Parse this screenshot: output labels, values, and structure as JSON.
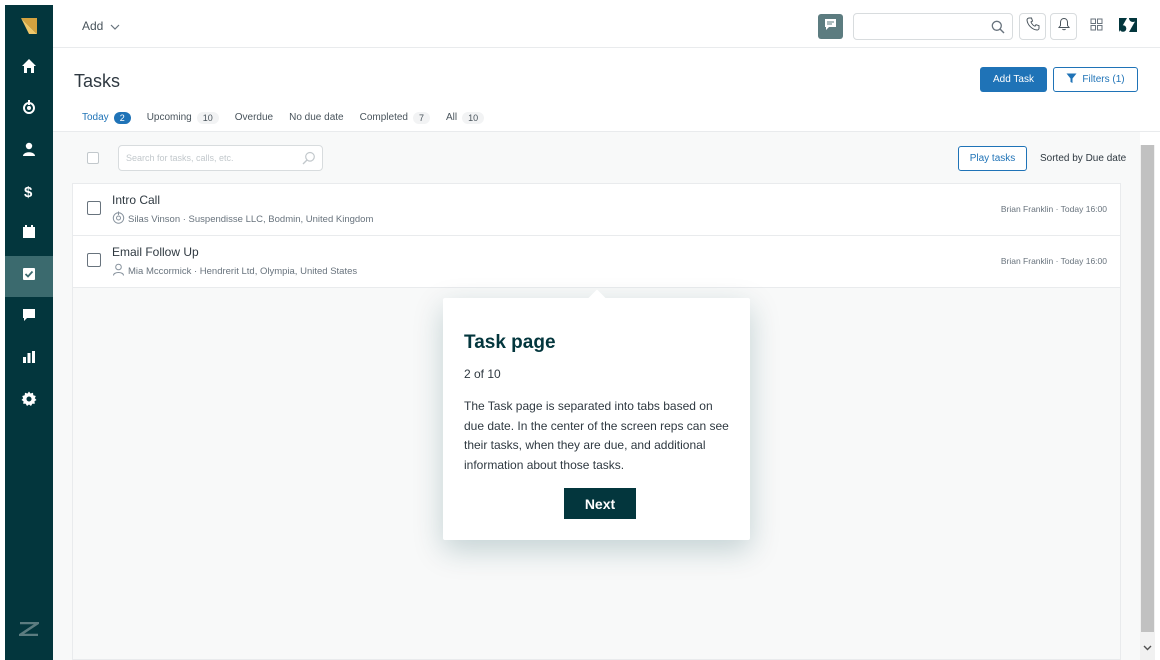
{
  "colors": {
    "sidebar": "#03363d",
    "sidebar_active": "#3b6a6e",
    "primary": "#1f73b7",
    "brand_accent": "#d4a23f"
  },
  "sidebar": {
    "items": [
      {
        "icon": "home-icon"
      },
      {
        "icon": "leads-icon"
      },
      {
        "icon": "contacts-icon"
      },
      {
        "icon": "deals-icon"
      },
      {
        "icon": "calendar-icon"
      },
      {
        "icon": "tasks-icon",
        "active": true
      },
      {
        "icon": "messages-icon"
      },
      {
        "icon": "reports-icon"
      },
      {
        "icon": "settings-icon"
      }
    ]
  },
  "header": {
    "add_label": "Add",
    "search_value": ""
  },
  "page": {
    "title": "Tasks",
    "add_task_label": "Add Task",
    "filters_label": "Filters (1)"
  },
  "tabs": [
    {
      "label": "Today",
      "count": "2",
      "active": true
    },
    {
      "label": "Upcoming",
      "count": "10"
    },
    {
      "label": "Overdue",
      "count": ""
    },
    {
      "label": "No due date",
      "count": ""
    },
    {
      "label": "Completed",
      "count": "7"
    },
    {
      "label": "All",
      "count": "10"
    }
  ],
  "toolbar": {
    "search_placeholder": "Search for tasks, calls, etc.",
    "play_label": "Play tasks",
    "sorted_label": "Sorted by Due date"
  },
  "tasks": [
    {
      "title": "Intro Call",
      "meta": "Silas Vinson · Suspendisse LLC, Bodmin, United Kingdom",
      "meta_icon": "lead-icon",
      "right": "Brian Franklin · Today 16:00"
    },
    {
      "title": "Email Follow Up",
      "meta": "Mia Mccormick · Hendrerit Ltd, Olympia, United States",
      "meta_icon": "person-icon",
      "right": "Brian Franklin · Today 16:00"
    }
  ],
  "popover": {
    "title": "Task page",
    "step": "2 of 10",
    "body": "The Task page is separated into tabs based on due date. In the center of the screen reps can see their tasks, when they are due, and additional information about those tasks.",
    "next_label": "Next"
  }
}
